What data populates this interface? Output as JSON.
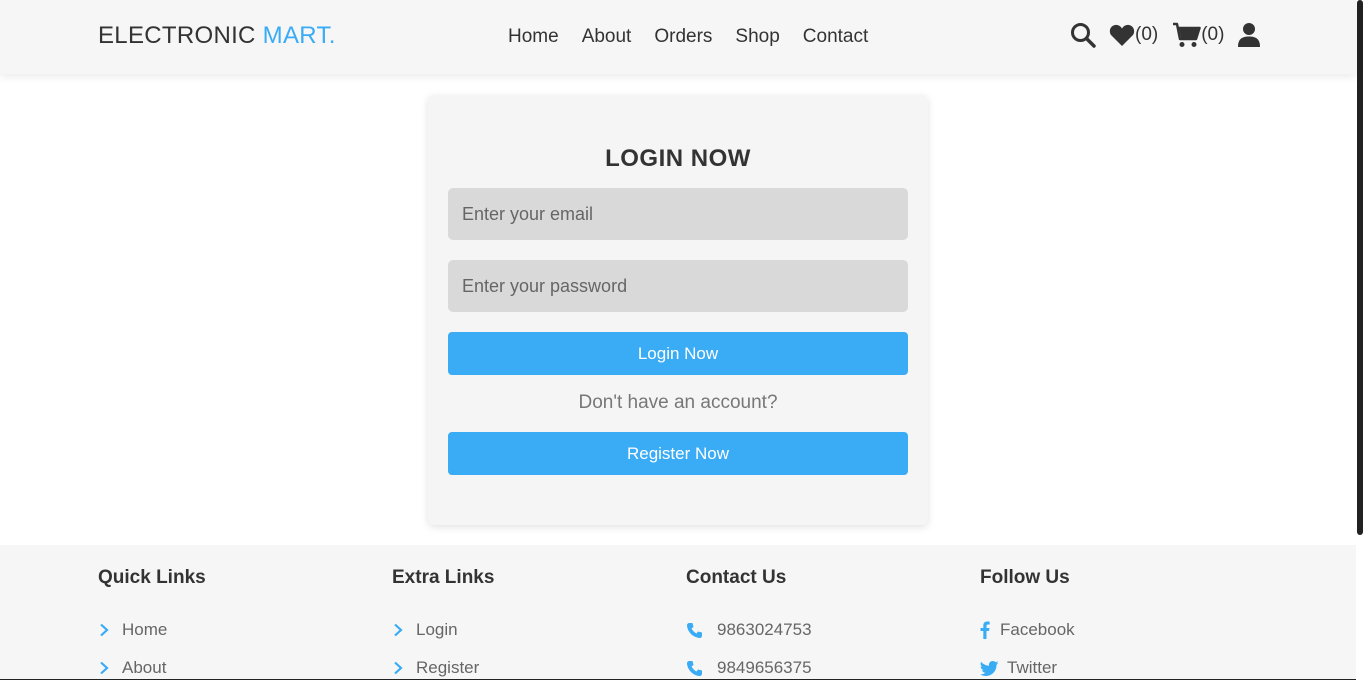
{
  "header": {
    "logo_main": "ELECTRONIC",
    "logo_accent": "MART.",
    "nav": [
      "Home",
      "About",
      "Orders",
      "Shop",
      "Contact"
    ],
    "wishlist_count": "(0)",
    "cart_count": "(0)",
    "icons": [
      "search-icon",
      "heart-icon",
      "cart-icon",
      "user-icon"
    ]
  },
  "login": {
    "title": "LOGIN NOW",
    "email_placeholder": "Enter your email",
    "password_placeholder": "Enter your password",
    "login_button": "Login Now",
    "account_text": "Don't have an account?",
    "register_button": "Register Now"
  },
  "footer": {
    "quick_links": {
      "title": "Quick Links",
      "items": [
        "Home",
        "About"
      ]
    },
    "extra_links": {
      "title": "Extra Links",
      "items": [
        "Login",
        "Register"
      ]
    },
    "contact": {
      "title": "Contact Us",
      "items": [
        "9863024753",
        "9849656375"
      ]
    },
    "follow": {
      "title": "Follow Us",
      "items": [
        "Facebook",
        "Twitter"
      ]
    }
  },
  "colors": {
    "accent": "#3aabf5",
    "header_bg": "#f6f6f6",
    "input_bg": "#d9d9d9"
  }
}
